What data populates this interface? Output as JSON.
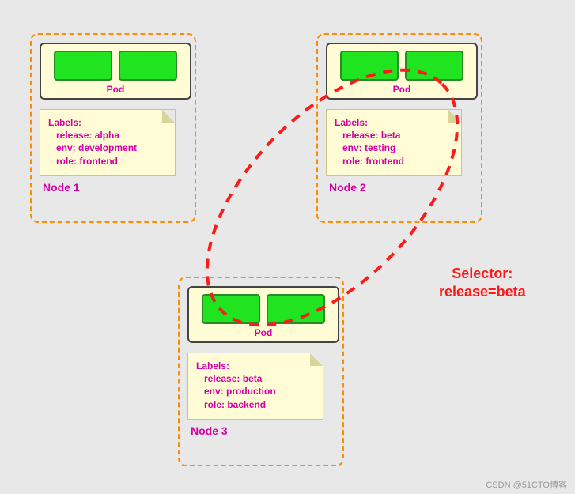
{
  "nodes": [
    {
      "title": "Node 1",
      "pod_label": "Pod",
      "labels_title": "Labels:",
      "labels": {
        "release": "release: alpha",
        "env": "env: development",
        "role": "role: frontend"
      }
    },
    {
      "title": "Node 2",
      "pod_label": "Pod",
      "labels_title": "Labels:",
      "labels": {
        "release": "release: beta",
        "env": "env: testing",
        "role": "role: frontend"
      }
    },
    {
      "title": "Node 3",
      "pod_label": "Pod",
      "labels_title": "Labels:",
      "labels": {
        "release": "release: beta",
        "env": "env: production",
        "role": "role: backend"
      }
    }
  ],
  "selector": {
    "line1": "Selector:",
    "line2": "release=beta"
  },
  "watermark": "CSDN @51CTO博客"
}
